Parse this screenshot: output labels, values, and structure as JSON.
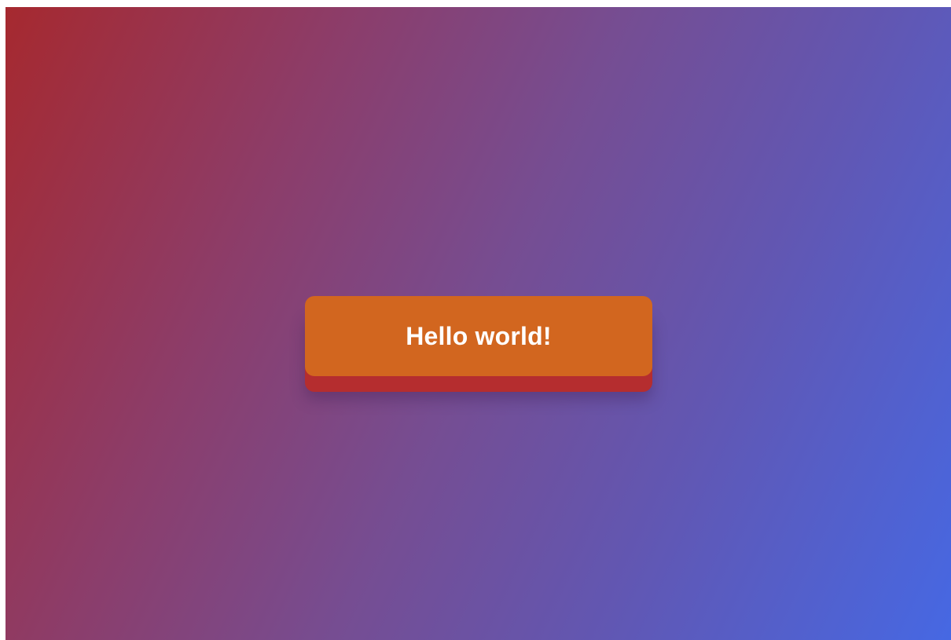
{
  "button": {
    "label": "Hello world!"
  },
  "colors": {
    "gradient_start": "#a6292f",
    "gradient_mid": "#764d92",
    "gradient_end": "#4668e3",
    "button_face": "#d2661f",
    "button_base": "#b52d2f",
    "button_text": "#ffffff"
  }
}
